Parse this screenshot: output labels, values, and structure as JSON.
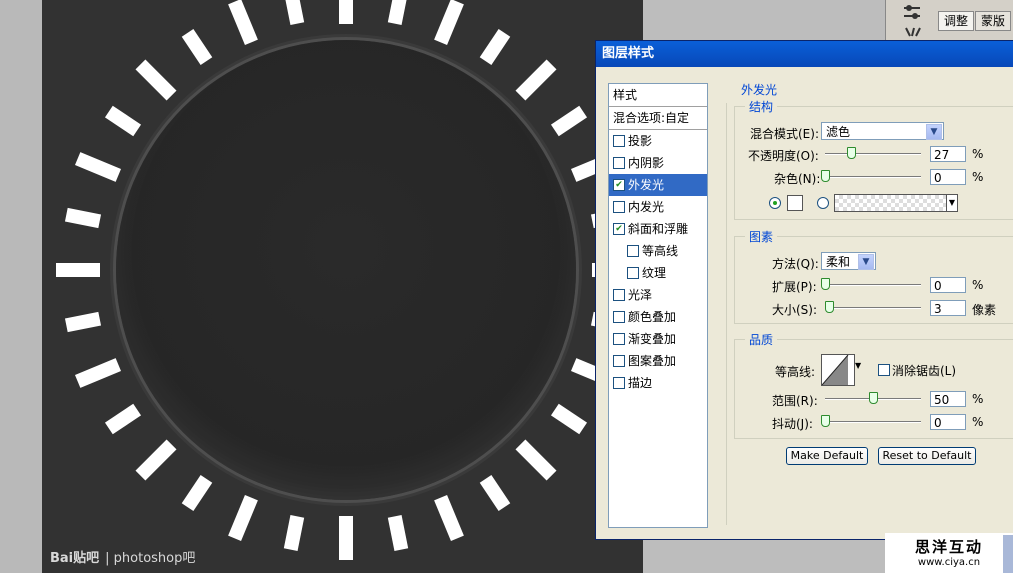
{
  "watermark": {
    "logo": "Bai贴吧",
    "text": "| photoshop吧"
  },
  "panel": {
    "tabs": [
      "调整",
      "蒙版"
    ]
  },
  "dialog": {
    "title": "图层样式",
    "styles": [
      {
        "label": "样式",
        "checked": null,
        "header": true
      },
      {
        "label": "混合选项:自定",
        "checked": null,
        "header": true
      },
      {
        "label": "投影",
        "checked": false
      },
      {
        "label": "内阴影",
        "checked": false
      },
      {
        "label": "外发光",
        "checked": true,
        "selected": true
      },
      {
        "label": "内发光",
        "checked": false
      },
      {
        "label": "斜面和浮雕",
        "checked": true
      },
      {
        "label": "等高线",
        "checked": false,
        "indent": true
      },
      {
        "label": "纹理",
        "checked": false,
        "indent": true
      },
      {
        "label": "光泽",
        "checked": false
      },
      {
        "label": "颜色叠加",
        "checked": false
      },
      {
        "label": "渐变叠加",
        "checked": false
      },
      {
        "label": "图案叠加",
        "checked": false
      },
      {
        "label": "描边",
        "checked": false
      }
    ],
    "section_title": "外发光",
    "structure": {
      "legend": "结构",
      "blend_mode_label": "混合模式(E):",
      "blend_mode_value": "滤色",
      "opacity_label": "不透明度(O):",
      "opacity_value": "27",
      "opacity_percent": 27,
      "noise_label": "杂色(N):",
      "noise_value": "0",
      "noise_percent": 0,
      "unit_percent": "%"
    },
    "elements": {
      "legend": "图素",
      "technique_label": "方法(Q):",
      "technique_value": "柔和",
      "spread_label": "扩展(P):",
      "spread_value": "0",
      "spread_percent": 0,
      "size_label": "大小(S):",
      "size_value": "3",
      "size_unit": "像素",
      "unit_percent": "%"
    },
    "quality": {
      "legend": "品质",
      "contour_label": "等高线:",
      "antialias_label": "消除锯齿(L)",
      "range_label": "范围(R):",
      "range_value": "50",
      "range_percent": 50,
      "jitter_label": "抖动(J):",
      "jitter_value": "0",
      "jitter_percent": 0,
      "unit_percent": "%"
    },
    "buttons": {
      "make_default": "Make Default",
      "reset_default": "Reset to Default"
    }
  },
  "logo": {
    "main": "思洋互动",
    "sub": "www.ciya.cn"
  }
}
